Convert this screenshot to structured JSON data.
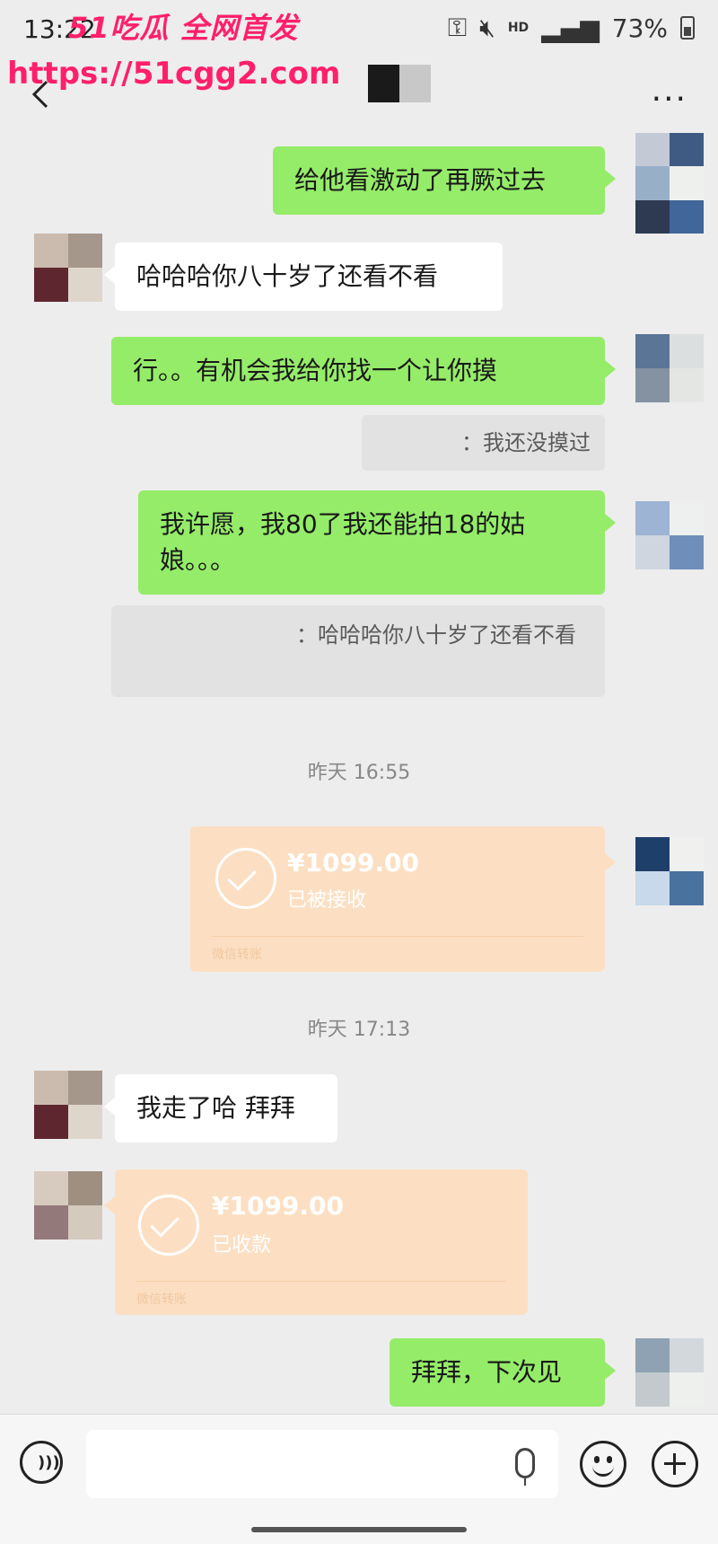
{
  "status_bar": {
    "time": "13:22",
    "battery": "73%",
    "network": "HD"
  },
  "watermark": {
    "line1": "51吃瓜 全网首发",
    "line2": "https://51cgg2.com"
  },
  "nav": {
    "more": "···"
  },
  "messages": {
    "m1": "给他看激动了再厥过去",
    "m2": "哈哈哈你八十岁了还看不看",
    "m3": "行。。有机会我给你找一个让你摸",
    "q1": "：我还没摸过",
    "m4": "我许愿，我80了我还能拍18的姑娘。。。",
    "q2": "：哈哈哈你八十岁了还看不看",
    "ts1": "昨天 16:55",
    "t1_amount": "¥1099.00",
    "t1_status": "已被接收",
    "t1_footer": "微信转账",
    "ts2": "昨天 17:13",
    "m5": "我走了哈 拜拜",
    "t2_amount": "¥1099.00",
    "t2_status": "已收款",
    "t2_footer": "微信转账",
    "m6": "拜拜，下次见"
  },
  "colors": {
    "my_bubble": "#95ec69",
    "their_bubble": "#ffffff",
    "transfer_card": "#fcdfc2",
    "watermark": "#ff1f6b"
  }
}
